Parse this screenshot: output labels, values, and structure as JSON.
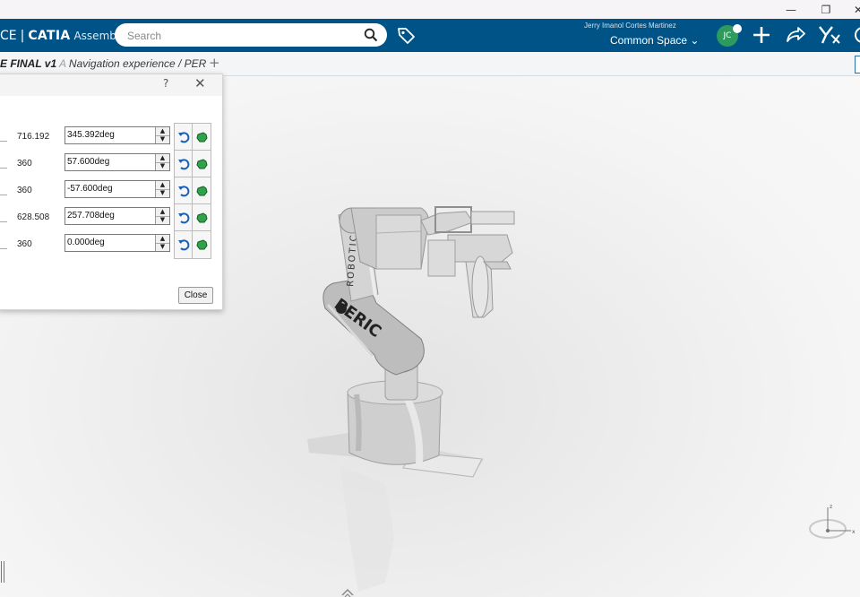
{
  "window": {
    "minimize": "—",
    "restore": "❐",
    "close": "✕"
  },
  "header": {
    "brand_prefix": "CE",
    "brand_sep": "|",
    "app_name": "CATIA",
    "app_context": "Assembl...",
    "search_placeholder": "Search",
    "user_name": "Jerry Imanol Cortes Martinez",
    "space_name": "Common Space ⌄",
    "avatar_initials": "JC",
    "accent_color": "#005386"
  },
  "tabbar": {
    "title_bold": "E FINAL v1",
    "title_fade": " A ",
    "title_rest": "Navigation experience / PER",
    "add_label": "+"
  },
  "dialog": {
    "help_label": "?",
    "close_x": "✕",
    "rows": [
      {
        "limit": "716.192",
        "value": "345.392deg"
      },
      {
        "limit": "360",
        "value": "57.600deg"
      },
      {
        "limit": "360",
        "value": "-57.600deg"
      },
      {
        "limit": "628.508",
        "value": "257.708deg"
      },
      {
        "limit": "360",
        "value": "0.000deg"
      }
    ],
    "close_button": "Close"
  },
  "robot": {
    "brand_text": "PERIC",
    "label_text": "ROBOTICS"
  },
  "axis": {
    "z": "z",
    "x": "x"
  }
}
